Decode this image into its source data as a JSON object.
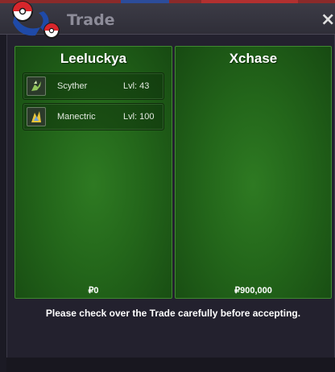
{
  "window": {
    "title": "Trade",
    "close_label": "×"
  },
  "left_panel": {
    "trainer": "Leeluckya",
    "money": "₽0",
    "pokemon": [
      {
        "name": "Scyther",
        "level": "Lvl: 43",
        "icon": "scyther-icon"
      },
      {
        "name": "Manectric",
        "level": "Lvl: 100",
        "icon": "manectric-icon"
      }
    ]
  },
  "right_panel": {
    "trainer": "Xchase",
    "money": "₽900,000",
    "pokemon": []
  },
  "notice": "Please check over the Trade carefully before accepting.",
  "colors": {
    "panel_green": "#2e7a22",
    "window_bg": "#23212e",
    "title_text": "#8d8c99"
  }
}
